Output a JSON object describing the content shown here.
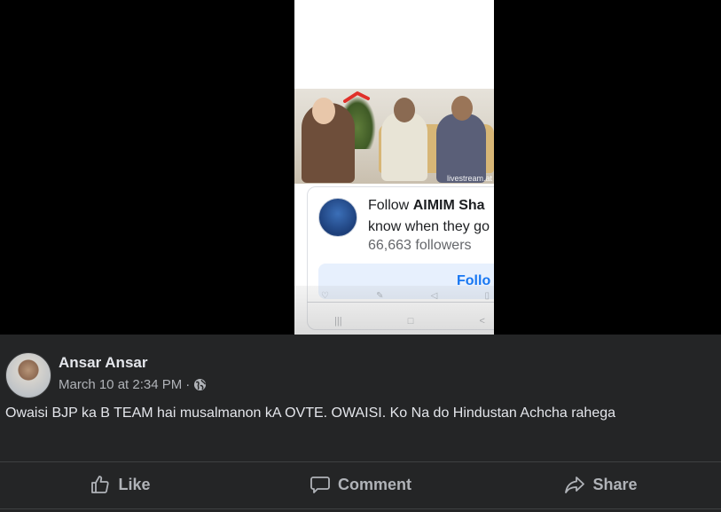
{
  "media": {
    "watermark": "livestream.at",
    "follow_card": {
      "follow_prefix": "Follow",
      "page_name": "AIMIM Sha",
      "line2": "know when they go",
      "followers": "66,663 followers",
      "button_label": "Follo"
    }
  },
  "post": {
    "author": "Ansar Ansar",
    "timestamp": "March 10 at 2:34 PM",
    "separator": "·",
    "privacy_icon": "globe-icon",
    "text": "Owaisi BJP ka B TEAM hai musalmanon kA OVTE. OWAISI. Ko Na do Hindustan Achcha rahega"
  },
  "actions": [
    {
      "label": "Like",
      "icon": "thumbs-up-icon"
    },
    {
      "label": "Comment",
      "icon": "comment-icon"
    },
    {
      "label": "Share",
      "icon": "share-icon"
    }
  ],
  "colors": {
    "background": "#000000",
    "panel": "#242526",
    "text_primary": "#e4e6eb",
    "text_secondary": "#b0b3b8",
    "accent": "#1877f2"
  }
}
